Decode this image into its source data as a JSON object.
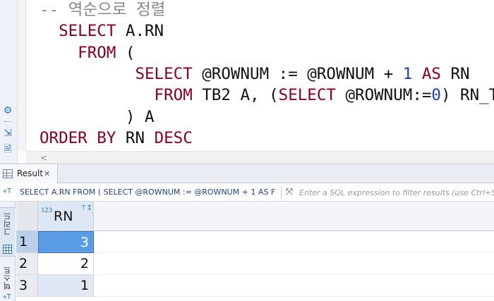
{
  "editor": {
    "lines": [
      {
        "parts": [
          {
            "t": "-- 역순으로 정렬",
            "c": "cmt"
          }
        ]
      },
      {
        "parts": [
          {
            "t": "  SELECT",
            "c": "kw"
          },
          {
            "t": " A.RN",
            "c": "tx"
          }
        ]
      },
      {
        "parts": [
          {
            "t": "    FROM",
            "c": "kw"
          },
          {
            "t": " (",
            "c": "tx"
          }
        ]
      },
      {
        "parts": [
          {
            "t": "          SELECT",
            "c": "kw"
          },
          {
            "t": " @ROWNUM := @ROWNUM + ",
            "c": "tx"
          },
          {
            "t": "1",
            "c": "num"
          },
          {
            "t": " AS",
            "c": "kw"
          },
          {
            "t": " RN",
            "c": "tx"
          }
        ]
      },
      {
        "parts": [
          {
            "t": "            FROM",
            "c": "kw"
          },
          {
            "t": " TB2 A, (",
            "c": "tx"
          },
          {
            "t": "SELECT",
            "c": "kw"
          },
          {
            "t": " @ROWNUM:=",
            "c": "tx"
          },
          {
            "t": "0",
            "c": "num"
          },
          {
            "t": ") RN_TB",
            "c": "tx"
          }
        ]
      },
      {
        "parts": [
          {
            "t": "         ) A",
            "c": "tx"
          }
        ]
      },
      {
        "parts": [
          {
            "t": "ORDER BY",
            "c": "kw"
          },
          {
            "t": " RN ",
            "c": "tx"
          },
          {
            "t": "DESC",
            "c": "kw"
          }
        ]
      }
    ],
    "gutter_icons": [
      "gear-icon",
      "export-icon",
      "file-warning-icon"
    ],
    "scroll_left_glyph": "<"
  },
  "result": {
    "tab_label": "Result",
    "tab_close": "✕",
    "filter_sql": "SELECT A.RN FROM ( SELECT @ROWNUM := @ROWNUM + 1 AS F",
    "filter_placeholder": "Enter a SQL expression to filter results (use Ctrl+Space)",
    "vtabs": {
      "grid_label": "그리드",
      "text_label": "텍스트"
    },
    "column": {
      "type_badge": "123",
      "name": "RN"
    },
    "rows": [
      {
        "num": "1",
        "value": "3",
        "selected": true
      },
      {
        "num": "2",
        "value": "2",
        "selected": false
      },
      {
        "num": "3",
        "value": "1",
        "selected": false
      }
    ]
  },
  "colors": {
    "keyword": "#8b0021",
    "number": "#1f3acc",
    "comment": "#888888",
    "selection": "#5b9ce6"
  }
}
